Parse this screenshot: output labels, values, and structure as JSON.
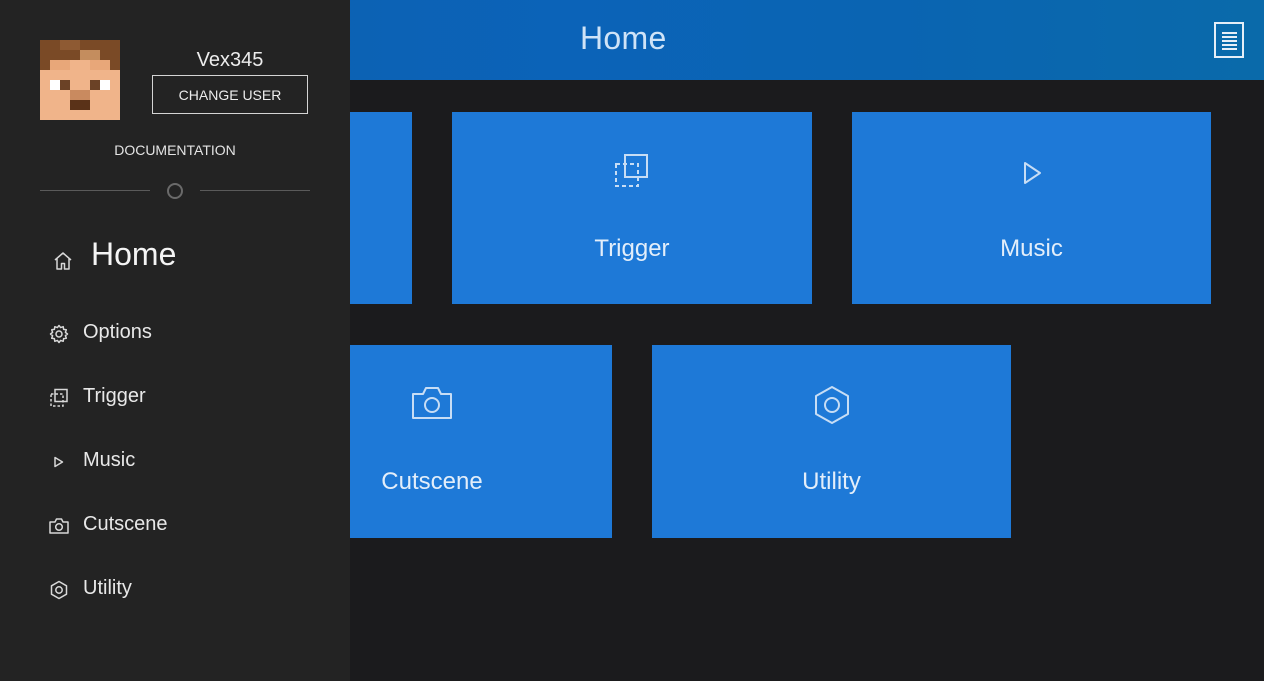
{
  "header": {
    "title": "Home",
    "doc_icon": "document-icon",
    "gradient": [
      "#0d5fae",
      "#0a6aaa"
    ]
  },
  "sidebar": {
    "avatar_icon": "pixel-avatar-icon",
    "username": "Vex345",
    "change_user_label": "CHANGE USER",
    "documentation_label": "DOCUMENTATION",
    "nav": [
      {
        "label": "Home",
        "icon": "home-icon",
        "active": true
      },
      {
        "label": "Options",
        "icon": "gear-icon",
        "active": false
      },
      {
        "label": "Trigger",
        "icon": "trigger-icon",
        "active": false
      },
      {
        "label": "Music",
        "icon": "play-icon",
        "active": false
      },
      {
        "label": "Cutscene",
        "icon": "camera-icon",
        "active": false
      },
      {
        "label": "Utility",
        "icon": "hexagon-nut-icon",
        "active": false
      }
    ]
  },
  "tiles": [
    {
      "label": "Trigger",
      "icon": "trigger-icon"
    },
    {
      "label": "Music",
      "icon": "play-icon"
    },
    {
      "label": "Cutscene",
      "icon": "camera-icon"
    },
    {
      "label": "Utility",
      "icon": "hexagon-nut-icon"
    }
  ],
  "colors": {
    "background": "#1b1b1d",
    "sidebar": "#232323",
    "tile": "#1e79d7",
    "accent_text": "#cfe3f7"
  }
}
